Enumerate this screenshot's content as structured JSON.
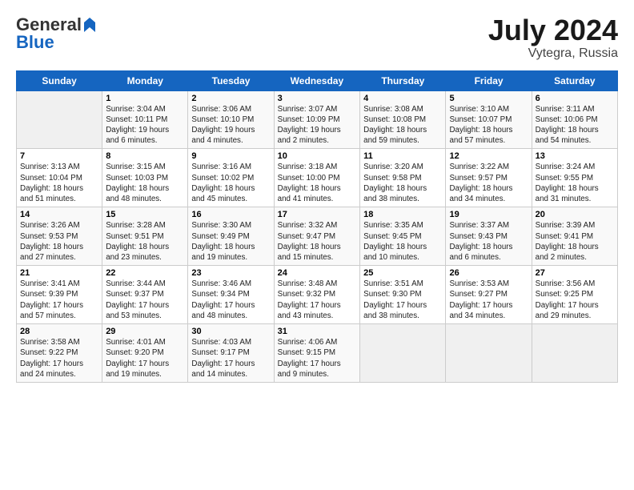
{
  "header": {
    "logo_general": "General",
    "logo_blue": "Blue",
    "title": "July 2024",
    "location": "Vytegra, Russia"
  },
  "days_of_week": [
    "Sunday",
    "Monday",
    "Tuesday",
    "Wednesday",
    "Thursday",
    "Friday",
    "Saturday"
  ],
  "weeks": [
    [
      {
        "day": "",
        "info": ""
      },
      {
        "day": "1",
        "info": "Sunrise: 3:04 AM\nSunset: 10:11 PM\nDaylight: 19 hours\nand 6 minutes."
      },
      {
        "day": "2",
        "info": "Sunrise: 3:06 AM\nSunset: 10:10 PM\nDaylight: 19 hours\nand 4 minutes."
      },
      {
        "day": "3",
        "info": "Sunrise: 3:07 AM\nSunset: 10:09 PM\nDaylight: 19 hours\nand 2 minutes."
      },
      {
        "day": "4",
        "info": "Sunrise: 3:08 AM\nSunset: 10:08 PM\nDaylight: 18 hours\nand 59 minutes."
      },
      {
        "day": "5",
        "info": "Sunrise: 3:10 AM\nSunset: 10:07 PM\nDaylight: 18 hours\nand 57 minutes."
      },
      {
        "day": "6",
        "info": "Sunrise: 3:11 AM\nSunset: 10:06 PM\nDaylight: 18 hours\nand 54 minutes."
      }
    ],
    [
      {
        "day": "7",
        "info": "Sunrise: 3:13 AM\nSunset: 10:04 PM\nDaylight: 18 hours\nand 51 minutes."
      },
      {
        "day": "8",
        "info": "Sunrise: 3:15 AM\nSunset: 10:03 PM\nDaylight: 18 hours\nand 48 minutes."
      },
      {
        "day": "9",
        "info": "Sunrise: 3:16 AM\nSunset: 10:02 PM\nDaylight: 18 hours\nand 45 minutes."
      },
      {
        "day": "10",
        "info": "Sunrise: 3:18 AM\nSunset: 10:00 PM\nDaylight: 18 hours\nand 41 minutes."
      },
      {
        "day": "11",
        "info": "Sunrise: 3:20 AM\nSunset: 9:58 PM\nDaylight: 18 hours\nand 38 minutes."
      },
      {
        "day": "12",
        "info": "Sunrise: 3:22 AM\nSunset: 9:57 PM\nDaylight: 18 hours\nand 34 minutes."
      },
      {
        "day": "13",
        "info": "Sunrise: 3:24 AM\nSunset: 9:55 PM\nDaylight: 18 hours\nand 31 minutes."
      }
    ],
    [
      {
        "day": "14",
        "info": "Sunrise: 3:26 AM\nSunset: 9:53 PM\nDaylight: 18 hours\nand 27 minutes."
      },
      {
        "day": "15",
        "info": "Sunrise: 3:28 AM\nSunset: 9:51 PM\nDaylight: 18 hours\nand 23 minutes."
      },
      {
        "day": "16",
        "info": "Sunrise: 3:30 AM\nSunset: 9:49 PM\nDaylight: 18 hours\nand 19 minutes."
      },
      {
        "day": "17",
        "info": "Sunrise: 3:32 AM\nSunset: 9:47 PM\nDaylight: 18 hours\nand 15 minutes."
      },
      {
        "day": "18",
        "info": "Sunrise: 3:35 AM\nSunset: 9:45 PM\nDaylight: 18 hours\nand 10 minutes."
      },
      {
        "day": "19",
        "info": "Sunrise: 3:37 AM\nSunset: 9:43 PM\nDaylight: 18 hours\nand 6 minutes."
      },
      {
        "day": "20",
        "info": "Sunrise: 3:39 AM\nSunset: 9:41 PM\nDaylight: 18 hours\nand 2 minutes."
      }
    ],
    [
      {
        "day": "21",
        "info": "Sunrise: 3:41 AM\nSunset: 9:39 PM\nDaylight: 17 hours\nand 57 minutes."
      },
      {
        "day": "22",
        "info": "Sunrise: 3:44 AM\nSunset: 9:37 PM\nDaylight: 17 hours\nand 53 minutes."
      },
      {
        "day": "23",
        "info": "Sunrise: 3:46 AM\nSunset: 9:34 PM\nDaylight: 17 hours\nand 48 minutes."
      },
      {
        "day": "24",
        "info": "Sunrise: 3:48 AM\nSunset: 9:32 PM\nDaylight: 17 hours\nand 43 minutes."
      },
      {
        "day": "25",
        "info": "Sunrise: 3:51 AM\nSunset: 9:30 PM\nDaylight: 17 hours\nand 38 minutes."
      },
      {
        "day": "26",
        "info": "Sunrise: 3:53 AM\nSunset: 9:27 PM\nDaylight: 17 hours\nand 34 minutes."
      },
      {
        "day": "27",
        "info": "Sunrise: 3:56 AM\nSunset: 9:25 PM\nDaylight: 17 hours\nand 29 minutes."
      }
    ],
    [
      {
        "day": "28",
        "info": "Sunrise: 3:58 AM\nSunset: 9:22 PM\nDaylight: 17 hours\nand 24 minutes."
      },
      {
        "day": "29",
        "info": "Sunrise: 4:01 AM\nSunset: 9:20 PM\nDaylight: 17 hours\nand 19 minutes."
      },
      {
        "day": "30",
        "info": "Sunrise: 4:03 AM\nSunset: 9:17 PM\nDaylight: 17 hours\nand 14 minutes."
      },
      {
        "day": "31",
        "info": "Sunrise: 4:06 AM\nSunset: 9:15 PM\nDaylight: 17 hours\nand 9 minutes."
      },
      {
        "day": "",
        "info": ""
      },
      {
        "day": "",
        "info": ""
      },
      {
        "day": "",
        "info": ""
      }
    ]
  ]
}
